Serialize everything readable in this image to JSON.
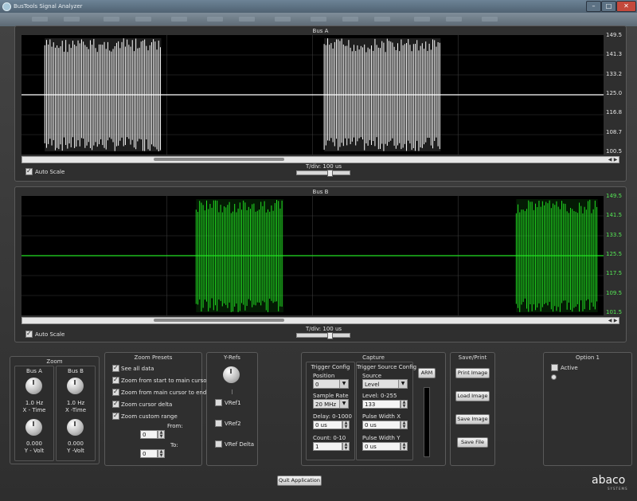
{
  "window": {
    "title": "BusTools Signal Analyzer",
    "min": "–",
    "max": "□",
    "close": "✕"
  },
  "busA": {
    "title": "Bus A",
    "color": "#ffffff",
    "y_ticks": [
      "149.5",
      "141.3",
      "133.2",
      "125.0",
      "116.8",
      "108.7",
      "100.5"
    ],
    "baseline": 125.0,
    "ymin": 100.5,
    "ymax": 149.5,
    "bursts": [
      [
        0.04,
        0.24
      ],
      [
        0.52,
        0.72
      ]
    ],
    "auto_scale": "Auto Scale",
    "tdiv": "T/div: 100 us",
    "scroll_pos": 0.22,
    "scroll_len": 0.22
  },
  "busB": {
    "title": "Bus B",
    "color": "#22e022",
    "y_ticks": [
      "149.5",
      "141.5",
      "133.5",
      "125.5",
      "117.5",
      "109.5",
      "101.5"
    ],
    "baseline": 125.5,
    "ymin": 101.5,
    "ymax": 149.5,
    "bursts": [
      [
        0.3,
        0.45
      ],
      [
        0.85,
        0.99
      ]
    ],
    "auto_scale": "Auto Scale",
    "tdiv": "T/div: 100 us",
    "scroll_pos": 0.22,
    "scroll_len": 0.22
  },
  "zoom": {
    "title": "Zoom",
    "busA": {
      "title": "Bus A",
      "x_value": "1.0 Hz",
      "x_label": "X - Time",
      "y_value": "0.000",
      "y_label": "Y - Volt"
    },
    "busB": {
      "title": "Bus B",
      "x_value": "1.0 Hz",
      "x_label": "X -Time",
      "y_value": "0.000",
      "y_label": "Y -Volt"
    }
  },
  "presets": {
    "title": "Zoom Presets",
    "options": [
      "See all data",
      "Zoom from start to main cursor",
      "Zoom from main cursor to end",
      "Zoom cursor delta",
      "Zoom custom range"
    ],
    "from_label": "From:",
    "from_value": "0",
    "to_label": "To:",
    "to_value": "0"
  },
  "yrefs": {
    "title": "Y-Refs",
    "items": [
      "VRef1",
      "VRef2",
      "VRef Delta"
    ]
  },
  "capture": {
    "title": "Capture",
    "trigger_config": {
      "title": "Trigger Config",
      "position_label": "Position",
      "position_value": "0",
      "rate_label": "Sample Rate",
      "rate_value": "20 MHz",
      "delay_label": "Delay: 0-1000",
      "delay_value": "0 us",
      "count_label": "Count: 0-10",
      "count_value": "1"
    },
    "trigger_source": {
      "title": "Trigger Source Config",
      "source_label": "Source",
      "source_value": "Level",
      "level_label": "Level: 0-255",
      "level_value": "133",
      "pwx_label": "Pulse Width X",
      "pwx_value": "0 us",
      "pwy_label": "Pulse Width Y",
      "pwy_value": "0 us"
    },
    "arm": "ARM"
  },
  "saveprint": {
    "title": "Save/Print",
    "buttons": [
      "Print Image",
      "Load Image",
      "Save Image",
      "Save File"
    ]
  },
  "option1": {
    "title": "Option 1",
    "active": "Active"
  },
  "footer": {
    "quit": "Quit Application",
    "logo": "abaco",
    "logo_sub": "SYSTEMS"
  }
}
